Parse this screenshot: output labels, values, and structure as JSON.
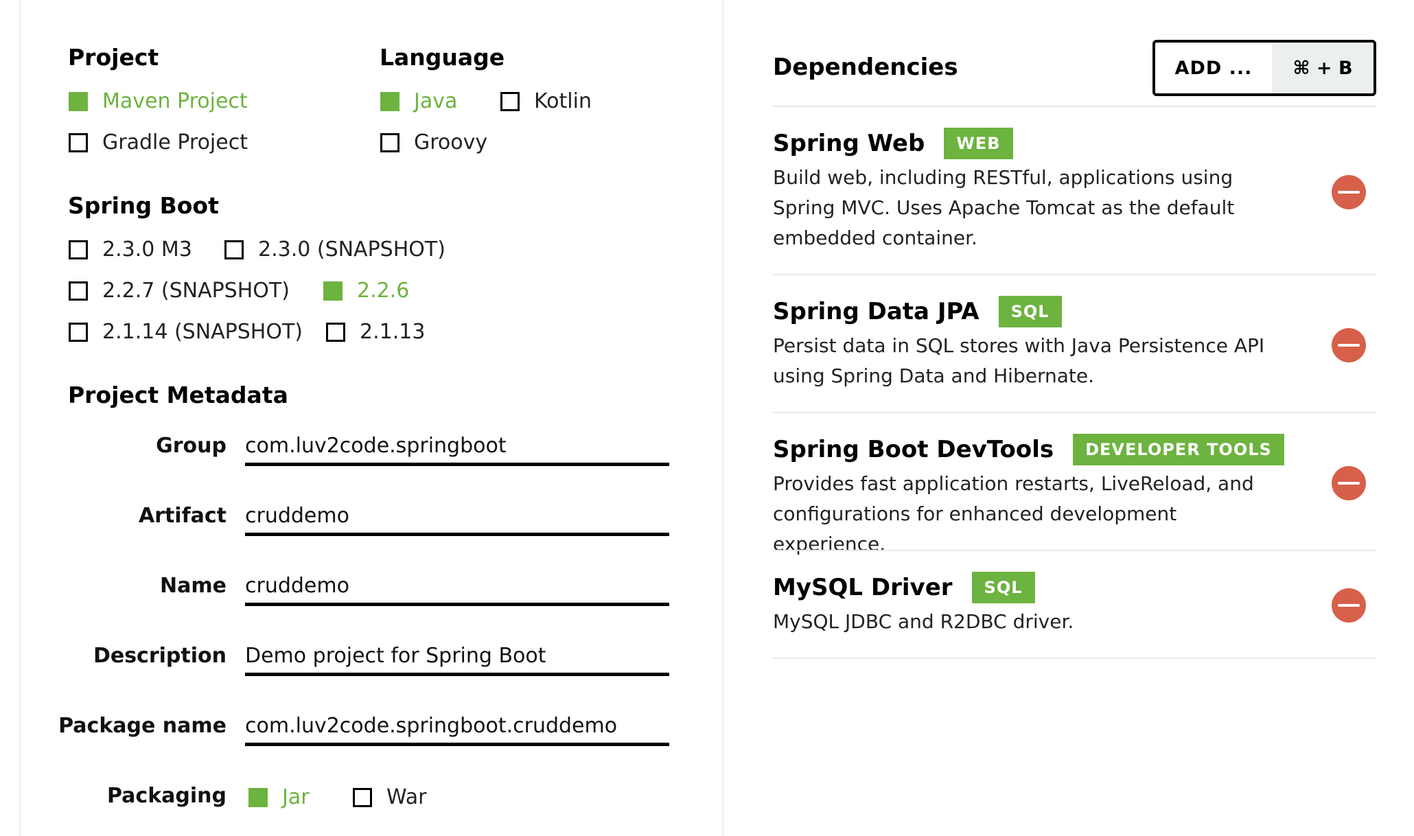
{
  "project": {
    "title": "Project",
    "options": [
      {
        "label": "Maven Project",
        "selected": true
      },
      {
        "label": "Gradle Project",
        "selected": false
      }
    ]
  },
  "language": {
    "title": "Language",
    "options": [
      {
        "label": "Java",
        "selected": true
      },
      {
        "label": "Kotlin",
        "selected": false
      },
      {
        "label": "Groovy",
        "selected": false
      }
    ]
  },
  "spring_boot": {
    "title": "Spring Boot",
    "options": [
      {
        "label": "2.3.0 M3",
        "selected": false
      },
      {
        "label": "2.3.0 (SNAPSHOT)",
        "selected": false
      },
      {
        "label": "2.2.7 (SNAPSHOT)",
        "selected": false
      },
      {
        "label": "2.2.6",
        "selected": true
      },
      {
        "label": "2.1.14 (SNAPSHOT)",
        "selected": false
      },
      {
        "label": "2.1.13",
        "selected": false
      }
    ]
  },
  "metadata": {
    "title": "Project Metadata",
    "fields": [
      {
        "label": "Group",
        "value": "com.luv2code.springboot"
      },
      {
        "label": "Artifact",
        "value": "cruddemo"
      },
      {
        "label": "Name",
        "value": "cruddemo"
      },
      {
        "label": "Description",
        "value": "Demo project for Spring Boot"
      },
      {
        "label": "Package name",
        "value": "com.luv2code.springboot.cruddemo"
      }
    ],
    "packaging": {
      "label": "Packaging",
      "options": [
        {
          "label": "Jar",
          "selected": true
        },
        {
          "label": "War",
          "selected": false
        }
      ]
    }
  },
  "dependencies": {
    "title": "Dependencies",
    "add_label": "ADD ...",
    "add_shortcut": "⌘ + B",
    "items": [
      {
        "name": "Spring Web",
        "tag": "WEB",
        "description": "Build web, including RESTful, applications using Spring MVC. Uses Apache Tomcat as the default embedded container."
      },
      {
        "name": "Spring Data JPA",
        "tag": "SQL",
        "description": "Persist data in SQL stores with Java Persistence API using Spring Data and Hibernate."
      },
      {
        "name": "Spring Boot DevTools",
        "tag": "DEVELOPER TOOLS",
        "description": "Provides fast application restarts, LiveReload, and configurations for enhanced development experience."
      },
      {
        "name": "MySQL Driver",
        "tag": "SQL",
        "description": "MySQL JDBC and R2DBC driver."
      }
    ]
  },
  "colors": {
    "accent": "#6db33f",
    "remove": "#d7604a",
    "shortcut_bg": "#ebeff0"
  }
}
